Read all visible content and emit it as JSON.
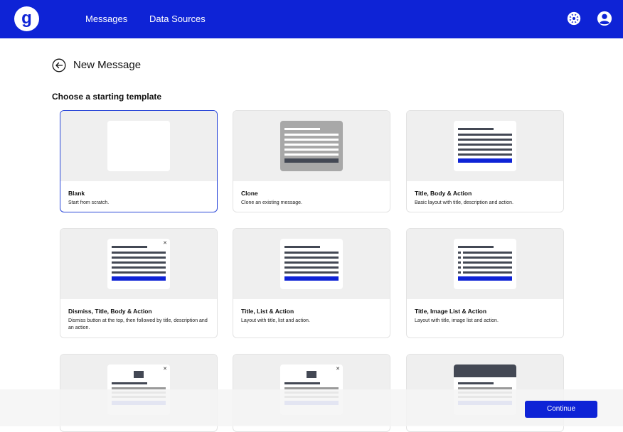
{
  "header": {
    "logo_letter": "g",
    "nav": [
      "Messages",
      "Data Sources"
    ]
  },
  "page": {
    "title": "New Message",
    "subtitle": "Choose a starting template"
  },
  "templates": [
    {
      "name": "Blank",
      "desc": "Start from scratch.",
      "selected": true
    },
    {
      "name": "Clone",
      "desc": "Clone an existing message."
    },
    {
      "name": "Title, Body & Action",
      "desc": "Basic layout with title, description and action."
    },
    {
      "name": "Dismiss, Title, Body & Action",
      "desc": "Dismiss button at the top, then followed by title, description and an action."
    },
    {
      "name": "Title, List & Action",
      "desc": "Layout with title, list and action."
    },
    {
      "name": "Title, Image List & Action",
      "desc": "Layout with title, image list and action."
    }
  ],
  "footer": {
    "continue_label": "Continue"
  },
  "colors": {
    "brand": "#0e23d6",
    "selected_border": "#2a47d8",
    "preview_bg": "#efefef"
  },
  "icons": {
    "settings": "gear-icon",
    "account": "user-icon",
    "back": "back-arrow-icon",
    "dismiss": "close-icon"
  }
}
